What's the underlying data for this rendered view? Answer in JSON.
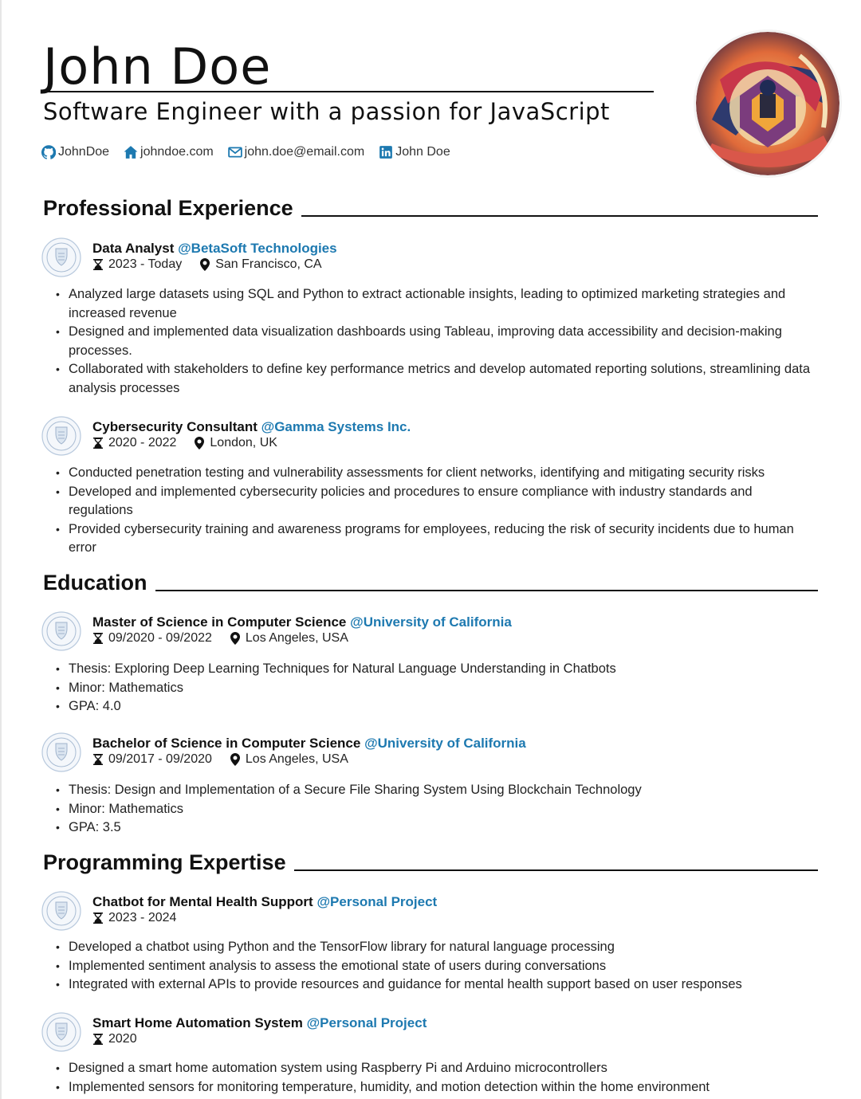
{
  "header": {
    "name": "John Doe",
    "subtitle": "Software Engineer with a passion for JavaScript",
    "contacts": [
      {
        "icon": "github-icon",
        "label": "JohnDoe"
      },
      {
        "icon": "home-icon",
        "label": "johndoe.com"
      },
      {
        "icon": "mail-icon",
        "label": "john.doe@email.com"
      },
      {
        "icon": "linkedin-icon",
        "label": "John Doe"
      }
    ]
  },
  "colors": {
    "accent": "#1d79b0",
    "text": "#111111"
  },
  "sections": {
    "experience": {
      "title": "Professional Experience",
      "entries": [
        {
          "role": "Data Analyst",
          "org": "@BetaSoft Technologies",
          "dates": "2023 - Today",
          "location": "San Francisco, CA",
          "bullets": [
            "Analyzed large datasets using SQL and Python to extract actionable insights, leading to optimized marketing strategies and increased revenue",
            "Designed and implemented data visualization dashboards using Tableau, improving data accessibility and decision-making processes.",
            "Collaborated with stakeholders to define key performance metrics and develop automated reporting solutions, streamlining data analysis processes"
          ]
        },
        {
          "role": "Cybersecurity Consultant",
          "org": "@Gamma Systems Inc.",
          "dates": "2020 - 2022",
          "location": "London, UK",
          "bullets": [
            "Conducted penetration testing and vulnerability assessments for client networks, identifying and mitigating security risks",
            "Developed and implemented cybersecurity policies and procedures to ensure compliance with industry standards and regulations",
            "Provided cybersecurity training and awareness programs for employees, reducing the risk of security incidents due to human error"
          ]
        }
      ]
    },
    "education": {
      "title": "Education",
      "entries": [
        {
          "role": "Master of Science in Computer Science",
          "org": "@University of California",
          "dates": "09/2020 - 09/2022",
          "location": "Los Angeles, USA",
          "bullets": [
            "Thesis: Exploring Deep Learning Techniques for Natural Language Understanding in Chatbots",
            "Minor: Mathematics",
            "GPA: 4.0"
          ]
        },
        {
          "role": "Bachelor of Science in Computer Science",
          "org": "@University of California",
          "dates": "09/2017 - 09/2020",
          "location": "Los Angeles, USA",
          "bullets": [
            "Thesis: Design and Implementation of a Secure File Sharing System Using Blockchain Technology",
            "Minor: Mathematics",
            "GPA: 3.5"
          ]
        }
      ]
    },
    "programming": {
      "title": "Programming Expertise",
      "entries": [
        {
          "role": "Chatbot for Mental Health Support",
          "org": "@Personal Project",
          "dates": "2023 - 2024",
          "bullets": [
            "Developed a chatbot using Python and the TensorFlow library for natural language processing",
            "Implemented sentiment analysis to assess the emotional state of users during conversations",
            "Integrated with external APIs to provide resources and guidance for mental health support based on user responses"
          ]
        },
        {
          "role": "Smart Home Automation System",
          "org": "@Personal Project",
          "dates": "2020",
          "bullets": [
            "Designed a smart home automation system using Raspberry Pi and Arduino microcontrollers",
            "Implemented sensors for monitoring temperature, humidity, and motion detection within the home environment"
          ]
        }
      ]
    }
  }
}
